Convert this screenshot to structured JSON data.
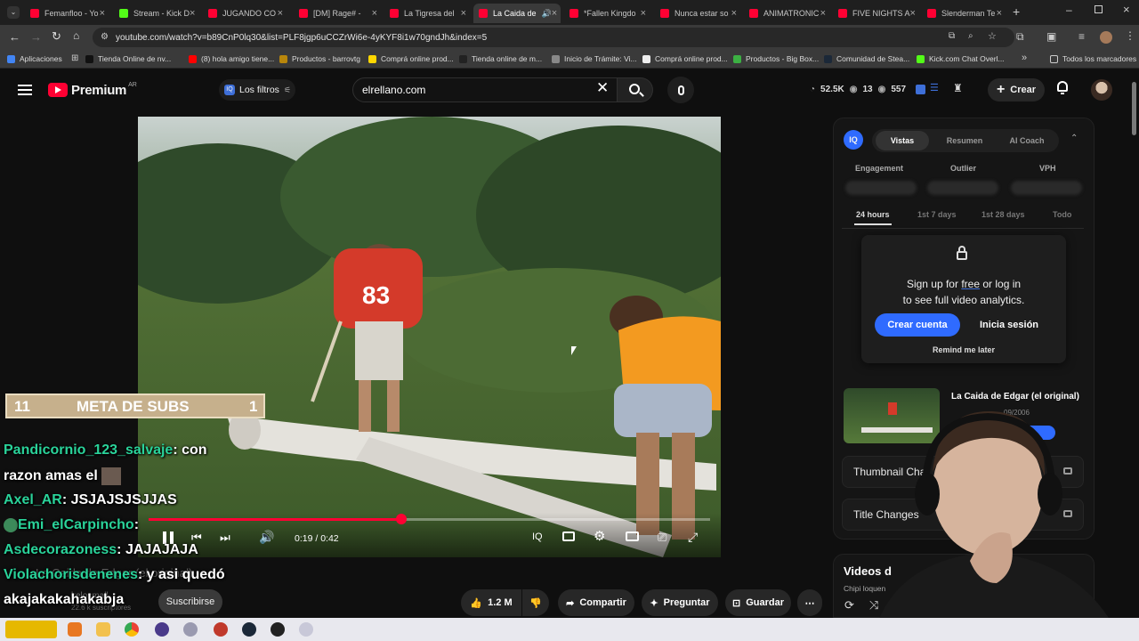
{
  "browser": {
    "tabs": [
      {
        "label": "Femanfloo - Yo",
        "active": false
      },
      {
        "label": "Stream - Kick D",
        "active": false
      },
      {
        "label": "JUGANDO CO",
        "active": false
      },
      {
        "label": "[DM] Rage# -",
        "active": false
      },
      {
        "label": "La Tigresa del",
        "active": false
      },
      {
        "label": "La Caida de",
        "active": true
      },
      {
        "label": "*Fallen Kingdo",
        "active": false
      },
      {
        "label": "Nunca estar so",
        "active": false
      },
      {
        "label": "ANIMATRONIC",
        "active": false
      },
      {
        "label": "FIVE NIGHTS A",
        "active": false
      },
      {
        "label": "Slenderman Te",
        "active": false
      }
    ],
    "url": "youtube.com/watch?v=b89CnP0lq30&list=PLF8jgp6uCCZrWi6e-4yKYF8i1w70gndJh&index=5",
    "bookmarks": [
      {
        "label": "Aplicaciones",
        "color": "#4285f4"
      },
      {
        "label": "Tienda Online de nv...",
        "color": "#111111"
      },
      {
        "label": "(8) hola amigo tiene...",
        "color": "#ff0000"
      },
      {
        "label": "Productos - barrovtg",
        "color": "#b8860b"
      },
      {
        "label": "Comprá online prod...",
        "color": "#ffd700"
      },
      {
        "label": "Tienda online de m...",
        "color": "#222222"
      },
      {
        "label": "Inicio de Trámite: Vi...",
        "color": "#888888"
      },
      {
        "label": "Comprá online prod...",
        "color": "#eeeeee"
      },
      {
        "label": "Productos - Big Box...",
        "color": "#3cb043"
      },
      {
        "label": "Comunidad de Stea...",
        "color": "#1b2838"
      },
      {
        "label": "Kick.com Chat Overl...",
        "color": "#53fc18"
      }
    ],
    "bookmarks_all": "Todos los marcadores"
  },
  "youtube": {
    "logo": "Premium",
    "region": "AR",
    "filters": "Los filtros",
    "search_value": "elrellano.com",
    "stats": {
      "a": "52.5K",
      "b": "13",
      "c": "557"
    },
    "create": "Crear"
  },
  "player": {
    "time": "0:19 / 0:42",
    "progress": 0.45,
    "jersey": "83"
  },
  "panel": {
    "badge": "IQ",
    "tabs": [
      "Vistas",
      "Resumen",
      "AI Coach"
    ],
    "stats": [
      "Engagement",
      "Outlier",
      "VPH"
    ],
    "ranges": [
      "24 hours",
      "1st 7 days",
      "1st 28 days",
      "Todo"
    ],
    "lock_text_1": "Sign up for",
    "lock_text_free": "free",
    "lock_text_2": "or log in",
    "lock_text_3": "to see full video analytics.",
    "create_account": "Crear cuenta",
    "login": "Inicia sesión",
    "remind": "Remind me later",
    "video_title": "La Caida de Edgar (el original)",
    "video_date": "09/2006",
    "thumbnail_changes": "Thumbnail Cha",
    "title_changes": "Title Changes",
    "videos_section": "Videos d",
    "videos_sub": "Chipi loquen"
  },
  "overlay": {
    "meta_left": "11",
    "meta_label": "META DE SUBS",
    "meta_right": "1",
    "chat": [
      {
        "user": "Pandicornio_123_salvaje",
        "msg": " con"
      },
      {
        "user": "",
        "msg": "razon amas el"
      },
      {
        "user": "Axel_AR",
        "msg": " JSJAJSJSJJAS"
      },
      {
        "user": "Emi_elCarpincho",
        "msg": ""
      },
      {
        "user": "Asdecorazoness",
        "msg": " JAJAJAJA"
      },
      {
        "user": "Violachorisdenenes",
        "msg": " y asi quedó"
      },
      {
        "user": "",
        "msg": "akajakakahakabja"
      }
    ],
    "faded_title": "La Caida de Edgar (el original)",
    "channel": "kelosmall",
    "subs": "22.6 k suscriptores"
  },
  "actions": {
    "subscribe": "Suscribirse",
    "likes": "1.2 M",
    "share": "Compartir",
    "ask": "Preguntar",
    "save": "Guardar"
  },
  "colors": {
    "accent": "#ff0033",
    "link": "#3ea6ff",
    "chat_user": "#2ad39a",
    "meta": "#c6b08c"
  }
}
